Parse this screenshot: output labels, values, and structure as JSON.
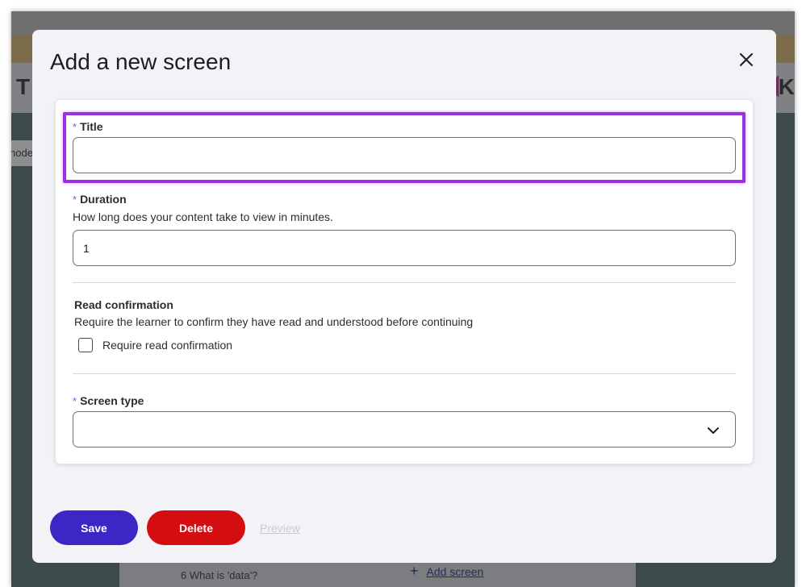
{
  "background_app": {
    "header_title": "T",
    "header_right": "K",
    "tab_label": "node",
    "list_item": "6 What is 'data'?",
    "add_screen_icon": "+",
    "add_screen_label": "Add screen"
  },
  "modal": {
    "title": "Add a new screen",
    "close_icon": "close-icon",
    "fields": {
      "title": {
        "required_marker": "*",
        "label": "Title",
        "value": ""
      },
      "duration": {
        "required_marker": "*",
        "label": "Duration",
        "help": "How long does your content take to view in minutes.",
        "value": "1"
      },
      "read_confirmation": {
        "label": "Read confirmation",
        "help": "Require the learner to confirm they have read and understood before continuing",
        "checkbox_label": "Require read confirmation",
        "checked": false
      },
      "screen_type": {
        "required_marker": "*",
        "label": "Screen type",
        "value": "",
        "icon": "chevron-down-icon"
      }
    },
    "buttons": {
      "save": "Save",
      "delete": "Delete",
      "preview": "Preview"
    }
  },
  "colors": {
    "highlight": "#9b30e6",
    "save_button": "#3b27c6",
    "delete_button": "#d40e10",
    "required_marker": "#6b63c9"
  }
}
